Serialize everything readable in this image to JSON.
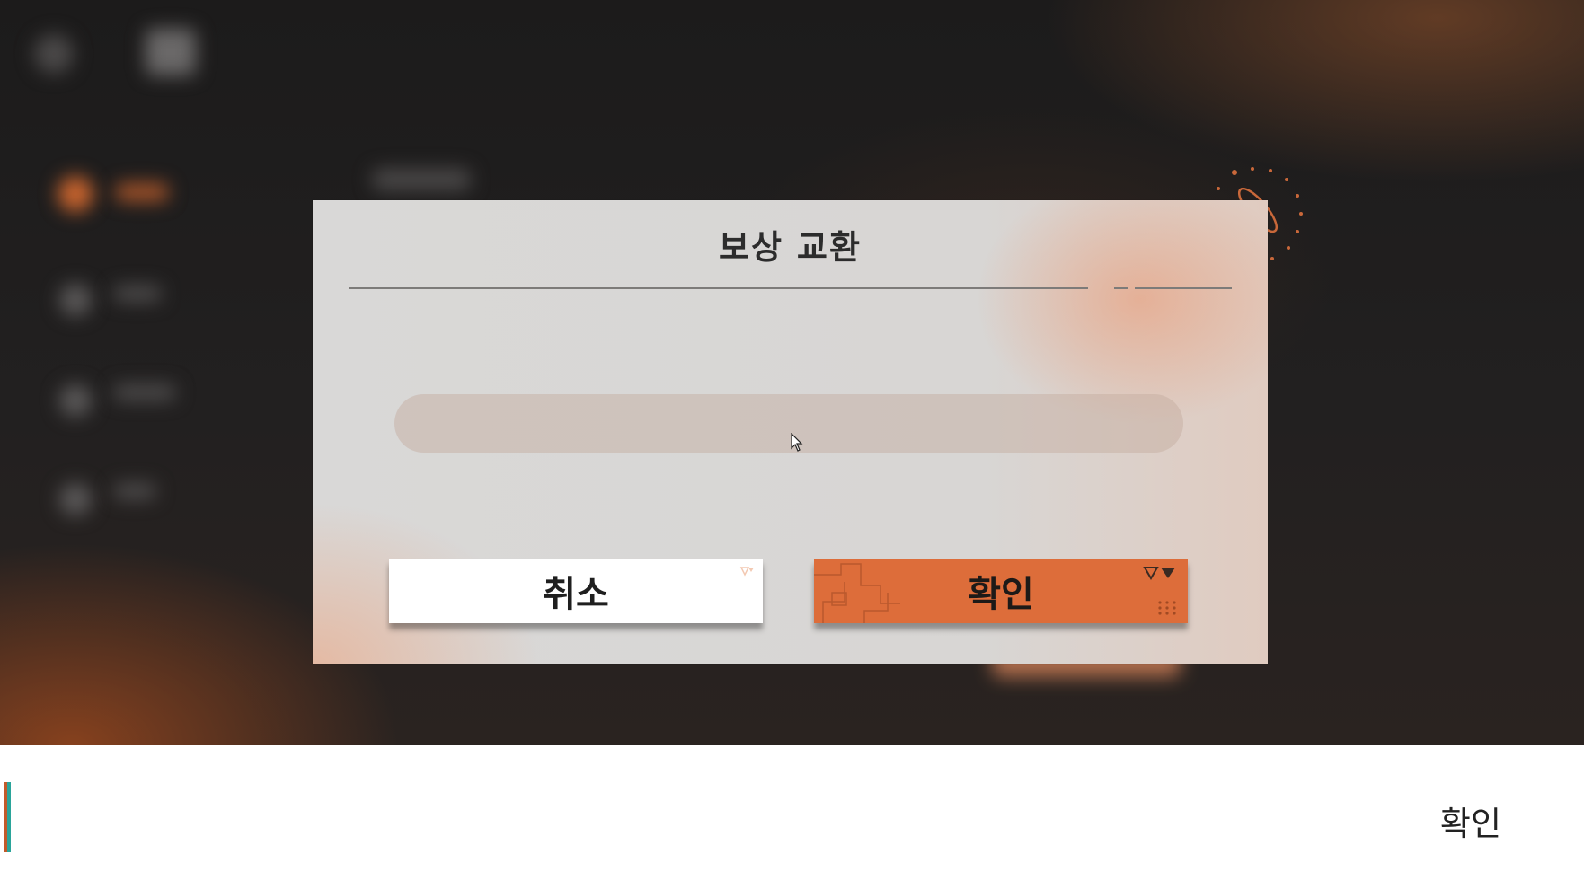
{
  "dialog": {
    "title": "보상 교환",
    "cancel_label": "취소",
    "confirm_label": "확인"
  },
  "caption": {
    "text": "확인"
  },
  "colors": {
    "confirm_button": "#dd6d3a",
    "cancel_button": "#ffffff",
    "dialog_background": "#d9d8d7",
    "accent_orange": "#c25a2a",
    "accent_teal": "#2aa49a"
  }
}
